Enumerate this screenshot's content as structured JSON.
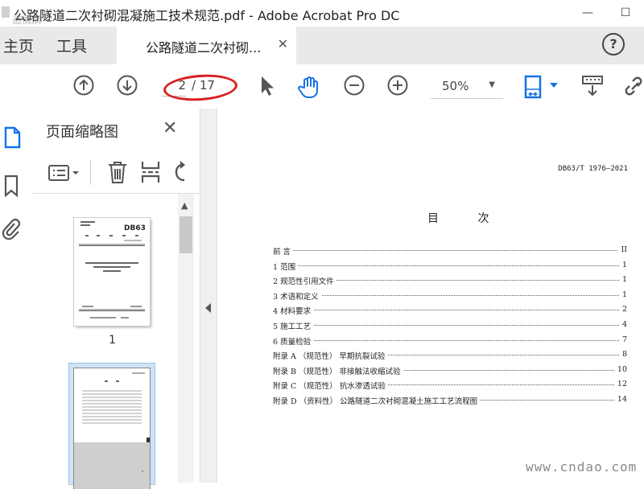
{
  "window": {
    "title": "公路隧道二次衬砌混凝施工技术规范.pdf - Adobe Acrobat Pro DC",
    "minimize_label": "—",
    "restore_label": "☐"
  },
  "tabs": {
    "home": "主页",
    "tools": "工具",
    "document": "公路隧道二次衬砌...",
    "close": "✕",
    "help": "?"
  },
  "toolbar": {
    "current_page": "2",
    "page_total": "/ 17",
    "zoom": "50%"
  },
  "panel": {
    "title": "页面缩略图",
    "close": "✕",
    "thumb1_label": "1",
    "thumb1_header": "DB63"
  },
  "document": {
    "standard_no": "DB63/T 1976—2021",
    "toc_title": "目 次",
    "toc": [
      {
        "label": "前 言",
        "page": "II"
      },
      {
        "label": "1 范围",
        "page": "1"
      },
      {
        "label": "2 规范性引用文件",
        "page": "1"
      },
      {
        "label": "3 术语和定义",
        "page": "1"
      },
      {
        "label": "4 材料要求",
        "page": "2"
      },
      {
        "label": "5 施工工艺",
        "page": "4"
      },
      {
        "label": "6 质量检验",
        "page": "7"
      },
      {
        "label": "附录 A （规范性） 早期抗裂试验",
        "page": "8"
      },
      {
        "label": "附录 B （规范性） 非接触法收缩试验",
        "page": "10"
      },
      {
        "label": "附录 C （规范性） 抗水渗透试验",
        "page": "12"
      },
      {
        "label": "附录 D （资料性） 公路隧道二次衬砌混凝土施工工艺流程图",
        "page": "14"
      }
    ]
  },
  "watermarks": {
    "top_left": "造價網",
    "bottom_right": "www.cndao.com"
  },
  "colors": {
    "frame": "#f4ea00",
    "annotation": "#d81e1e",
    "accent": "#1473e6"
  }
}
